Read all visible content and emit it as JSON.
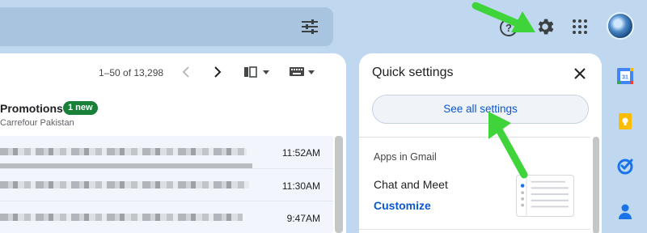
{
  "search": {
    "filter_icon": "tune-icon"
  },
  "header": {
    "help_icon": "help-icon",
    "settings_icon": "gear-icon",
    "apps_icon": "apps-grid-icon"
  },
  "toolbar": {
    "pagination": "1–50 of 13,298",
    "prev_icon": "chevron-left-icon",
    "next_icon": "chevron-right-icon"
  },
  "category": {
    "title": "Promotions",
    "badge": "1 new",
    "sender": "Carrefour Pakistan"
  },
  "messages": [
    {
      "time": "11:52AM"
    },
    {
      "time": "11:30AM"
    },
    {
      "time": "9:47AM"
    }
  ],
  "quick_settings": {
    "title": "Quick settings",
    "see_all": "See all settings",
    "section": "Apps in Gmail",
    "chat_label": "Chat and Meet",
    "customize": "Customize"
  },
  "right_rail": [
    "calendar-icon",
    "keep-icon",
    "tasks-icon",
    "contacts-icon"
  ],
  "colors": {
    "accent_blue": "#0b57d0",
    "badge_green": "#188038",
    "annotation_green": "#3ed43a",
    "background": "#bfd8f0"
  }
}
